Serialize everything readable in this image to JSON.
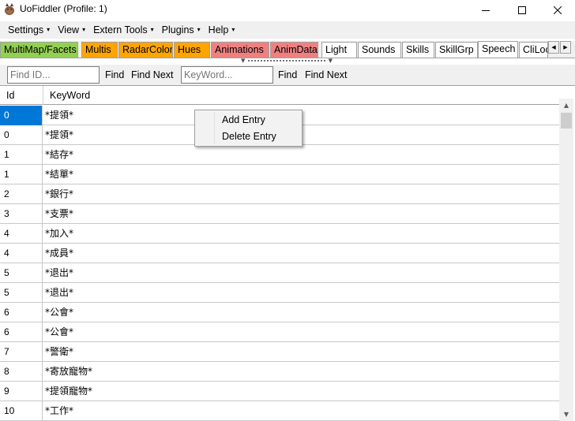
{
  "window": {
    "title": "UoFiddler (Profile: 1)",
    "minimize_glyph": "—",
    "maximize_glyph": "☐",
    "close_glyph": "✕"
  },
  "menu": [
    {
      "label": "Settings",
      "caret": "▾"
    },
    {
      "label": "View",
      "caret": "▾"
    },
    {
      "label": "Extern Tools",
      "caret": "▾"
    },
    {
      "label": "Plugins",
      "caret": "▾"
    },
    {
      "label": "Help",
      "caret": "▾"
    }
  ],
  "tabs": [
    {
      "label": "MultiMap/Facets",
      "color": "#92d050"
    },
    {
      "label": "Multis",
      "color": "#ffa500"
    },
    {
      "label": "RadarColor",
      "color": "#ffa500"
    },
    {
      "label": "Hues",
      "color": "#ffa500"
    },
    {
      "label": "Animations",
      "color": "#f08080"
    },
    {
      "label": "AnimData",
      "color": "#f08080"
    },
    {
      "label": "Light",
      "color": "#ffffff"
    },
    {
      "label": "Sounds",
      "color": "#ffffff"
    },
    {
      "label": "Skills",
      "color": "#ffffff"
    },
    {
      "label": "SkillGrp",
      "color": "#ffffff"
    },
    {
      "label": "Speech",
      "color": "#ffffff",
      "active": true
    },
    {
      "label": "CliLoc",
      "color": "#ffffff"
    }
  ],
  "tab_scroll": {
    "left": "◀",
    "right": "▶"
  },
  "splitter": {
    "left": "▼",
    "right": "▼"
  },
  "toolbar": {
    "id_placeholder": "Find ID...",
    "find_label_1": "Find",
    "findnext_label_1": "Find Next",
    "keyword_placeholder": "KeyWord...",
    "find_label_2": "Find",
    "findnext_label_2": "Find Next"
  },
  "grid": {
    "columns": [
      "Id",
      "KeyWord"
    ],
    "rows": [
      {
        "id": "0",
        "keyword": "*提領*",
        "selected": true
      },
      {
        "id": "0",
        "keyword": "*提領*"
      },
      {
        "id": "1",
        "keyword": "*結存*"
      },
      {
        "id": "1",
        "keyword": "*結單*"
      },
      {
        "id": "2",
        "keyword": "*銀行*"
      },
      {
        "id": "3",
        "keyword": "*支票*"
      },
      {
        "id": "4",
        "keyword": "*加入*"
      },
      {
        "id": "4",
        "keyword": "*成員*"
      },
      {
        "id": "5",
        "keyword": "*退出*"
      },
      {
        "id": "5",
        "keyword": "*退出*"
      },
      {
        "id": "6",
        "keyword": "*公會*"
      },
      {
        "id": "6",
        "keyword": "*公會*"
      },
      {
        "id": "7",
        "keyword": "*警衛*"
      },
      {
        "id": "8",
        "keyword": "*寄放寵物*"
      },
      {
        "id": "9",
        "keyword": "*提領寵物*"
      },
      {
        "id": "10",
        "keyword": "*工作*"
      }
    ],
    "scroll_up": "▲",
    "scroll_down": "▼"
  },
  "context_menu": {
    "items": [
      "Add Entry",
      "Delete Entry"
    ]
  }
}
